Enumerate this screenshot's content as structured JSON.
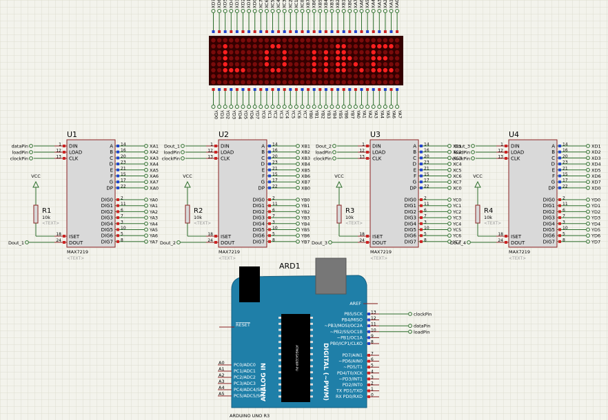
{
  "colors": {
    "background": "#f3f3ec",
    "grid": "#dcdccf",
    "chip_fill": "#d9d9d9",
    "chip_border": "#8a1f1f",
    "wire": "#2c6e2c",
    "label": "#000080",
    "pin_red": "#cc2222",
    "pin_blue": "#2244cc",
    "led_on": "#ff2020",
    "led_off": "#7a0b0b",
    "matrix_bg": "#330000",
    "arduino_fill": "#1f7fa8",
    "arduino_text": "#ffffff"
  },
  "matrix": {
    "top_labels": [
      "XD7",
      "XD6",
      "XD5",
      "XD4",
      "XD3",
      "XD2",
      "XD1",
      "XD0",
      "XC7",
      "XC6",
      "XC5",
      "XC4",
      "XC3",
      "XC2",
      "XC1",
      "XC0",
      "XB7",
      "XB6",
      "XB5",
      "XB4",
      "XB3",
      "XB2",
      "XB1",
      "XB0",
      "XA7",
      "XA6",
      "XA5",
      "XA4",
      "XA3",
      "XA2",
      "XA1",
      "XA0"
    ],
    "bottom_labels": [
      "YD0",
      "YD1",
      "YD2",
      "YD3",
      "YD4",
      "YD5",
      "YD6",
      "YD7",
      "YC0",
      "YC1",
      "YC2",
      "YC3",
      "YC4",
      "YC5",
      "YC6",
      "YC7",
      "YB0",
      "YB1",
      "YB2",
      "YB3",
      "YB4",
      "YB5",
      "YB6",
      "YB7",
      "YA0",
      "YA1",
      "YA2",
      "YA3",
      "YA4",
      "YA5",
      "YA6",
      "YA7"
    ],
    "rows": [
      "00000000000000000000000000000000",
      "00100000001100000000011000011110",
      "00100000010010000101011000010000",
      "00100000010010000101011100011100",
      "00100000010010000101011010010000",
      "00111100001100000101011001011110",
      "00000000000000000000000000000000",
      "00000000000000000000000000000000"
    ]
  },
  "chips": [
    {
      "ref": "U1",
      "part": "MAX7219",
      "text": "<TEXT>",
      "out_prefix": "XA",
      "dig_prefix": "YA",
      "in_nets": [
        "dataPin",
        "loadPin",
        "clockPin"
      ],
      "dout_net": "Dout_1",
      "res": {
        "ref": "R1",
        "value": "10k",
        "text": "<TEXT>"
      }
    },
    {
      "ref": "U2",
      "part": "MAX7219",
      "text": "<TEXT>",
      "out_prefix": "XB",
      "dig_prefix": "YB",
      "in_nets": [
        "Dout_1",
        "loadPin",
        "clockPin"
      ],
      "dout_net": "Dout_2",
      "res": {
        "ref": "R2",
        "value": "10k",
        "text": "<TEXT>"
      }
    },
    {
      "ref": "U3",
      "part": "MAX7219",
      "text": "<TEXT>",
      "out_prefix": "XC",
      "dig_prefix": "YC",
      "in_nets": [
        "Dout_2",
        "loadPin",
        "clockPin"
      ],
      "dout_net": "Dout_3",
      "res": {
        "ref": "R3",
        "value": "10k",
        "text": "<TEXT>"
      }
    },
    {
      "ref": "U4",
      "part": "MAX7219",
      "text": "<TEXT>",
      "out_prefix": "XD",
      "dig_prefix": "YD",
      "in_nets": [
        "Dout_3",
        "loadPin",
        "clockPin"
      ],
      "dout_net": "Dout_4",
      "res": {
        "ref": "R4",
        "value": "10k",
        "text": "<TEXT>"
      }
    }
  ],
  "chip_pins_left": [
    "DIN",
    "LOAD",
    "CLK"
  ],
  "chip_pin_nums_left": [
    "1",
    "12",
    "13"
  ],
  "chip_pins_right_seg": [
    "A",
    "B",
    "C",
    "D",
    "E",
    "F",
    "G",
    "DP"
  ],
  "chip_pin_nums_seg": [
    "14",
    "16",
    "20",
    "23",
    "21",
    "15",
    "17",
    "22"
  ],
  "chip_pins_right_dig": [
    "DIG0",
    "DIG1",
    "DIG2",
    "DIG3",
    "DIG4",
    "DIG5",
    "DIG6",
    "DIG7"
  ],
  "chip_pin_nums_dig": [
    "2",
    "11",
    "6",
    "7",
    "3",
    "10",
    "5",
    "8"
  ],
  "chip_iset": {
    "label": "ISET",
    "num": "18"
  },
  "chip_dout": {
    "label": "DOUT",
    "num": "24"
  },
  "vcc_label": "VCC",
  "seg_out_suffixes": [
    "1",
    "2",
    "3",
    "4",
    "5",
    "6",
    "7",
    "0"
  ],
  "dig_out_suffixes": [
    "0",
    "1",
    "2",
    "3",
    "4",
    "5",
    "6",
    "7"
  ],
  "arduino": {
    "ref": "ARD1",
    "footer": "ARDUINO UNO R3",
    "aref": "AREF",
    "reset": "RESET",
    "chip_text": "ATMEGA328P-PU",
    "analog_title": "ANALOG IN",
    "digital_title": "DIGITAL (~PWM)",
    "analog_pins": [
      {
        "ext": "A0",
        "int": "PC0/ADC0"
      },
      {
        "ext": "A1",
        "int": "PC1/ADC1"
      },
      {
        "ext": "A2",
        "int": "PC2/ADC2"
      },
      {
        "ext": "A3",
        "int": "PC3/ADC3"
      },
      {
        "ext": "A4",
        "int": "PC4/ADC4/SDA"
      },
      {
        "ext": "A5",
        "int": "PC5/ADC5/SCL"
      }
    ],
    "digital_upper": [
      {
        "label": "PB5/SCK",
        "num": "13",
        "net": "clockPin"
      },
      {
        "label": "PB4/MISO",
        "num": "12",
        "net": ""
      },
      {
        "label": "~PB3/MOSI/OC2A",
        "num": "11",
        "net": "dataPin"
      },
      {
        "label": "~PB2/SS/OC1B",
        "num": "10",
        "net": "loadPin"
      },
      {
        "label": "~PB1/OC1A",
        "num": "9",
        "net": ""
      },
      {
        "label": "PB0/ICP1/CLKO",
        "num": "8",
        "net": ""
      }
    ],
    "digital_lower": [
      {
        "label": "PD7/AIN1",
        "num": "7"
      },
      {
        "label": "~PD6/AIN0",
        "num": "6"
      },
      {
        "label": "~PD5/T1",
        "num": "5"
      },
      {
        "label": "PD4/T0/XCK",
        "num": "4"
      },
      {
        "label": "~PD3/INT1",
        "num": "3"
      },
      {
        "label": "PD2/INT0",
        "num": "2"
      },
      {
        "label": "TX PD1/TXD",
        "num": "1"
      },
      {
        "label": "RX PD0/RXD",
        "num": "0"
      }
    ]
  }
}
